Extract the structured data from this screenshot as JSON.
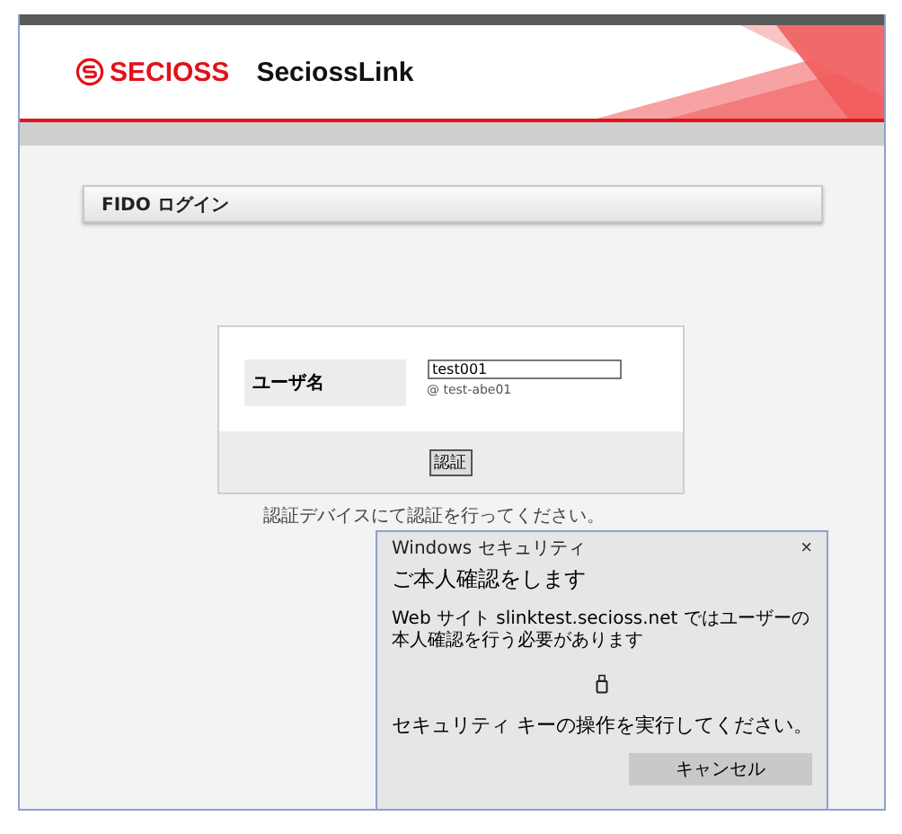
{
  "header": {
    "brand": "SECIOSS",
    "product": "SeciossLink"
  },
  "panel": {
    "title": "FIDO ログイン"
  },
  "form": {
    "label": "ユーザ名",
    "username": "test001",
    "account": "@ test-abe01",
    "submit": "認証"
  },
  "hint": "認証デバイスにて認証を行ってください。",
  "dialog": {
    "window_title": "Windows セキュリティ",
    "close": "×",
    "heading": "ご本人確認をします",
    "message": "Web サイト slinktest.secioss.net ではユーザーの本人確認を行う必要があります",
    "instruction": "セキュリティ キーの操作を実行してください。",
    "cancel": "キャンセル"
  }
}
